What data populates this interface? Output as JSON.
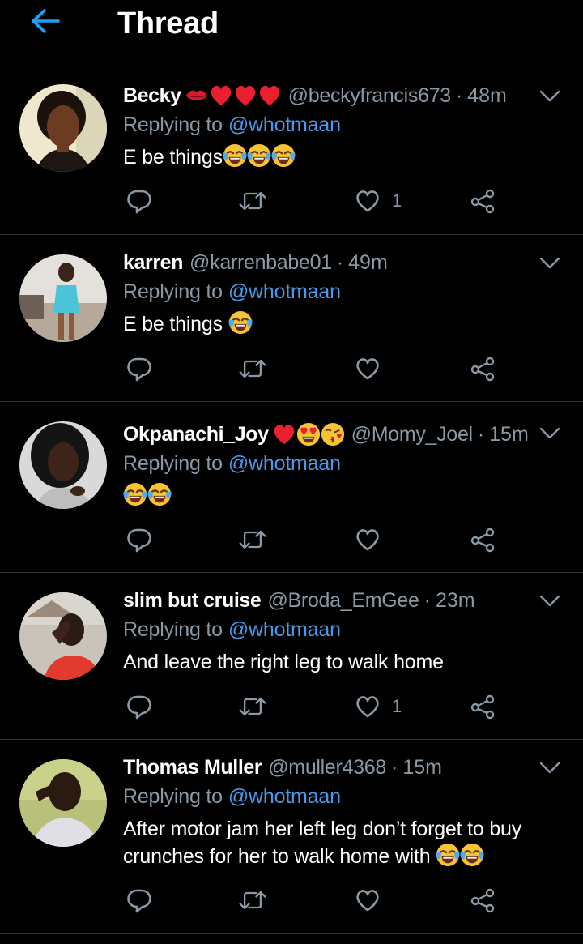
{
  "header": {
    "title": "Thread",
    "back_icon": "arrow-left-icon",
    "accent": "#1da1f2"
  },
  "colors": {
    "background": "#000000",
    "muted": "#8b98a5",
    "link": "#4a99e9",
    "divider": "#2f3336"
  },
  "tweets": [
    {
      "name": "Becky",
      "name_emojis": [
        "lips-icon",
        "red-heart-icon",
        "red-heart-icon",
        "red-heart-icon"
      ],
      "handle": "@beckyfrancis673",
      "time": "48m",
      "replying_label": "Replying to",
      "mention": "@whotmaan",
      "text": "E be things",
      "text_emojis": [
        "tears-of-joy-icon",
        "tears-of-joy-icon",
        "tears-of-joy-icon"
      ],
      "like_count": "1"
    },
    {
      "name": "karren",
      "name_emojis": [],
      "handle": "@karrenbabe01",
      "time": "49m",
      "replying_label": "Replying to",
      "mention": "@whotmaan",
      "text": "E be things",
      "text_emojis": [
        "tears-of-joy-icon"
      ],
      "like_count": ""
    },
    {
      "name": "Okpanachi_Joy",
      "name_emojis": [
        "red-heart-icon",
        "heart-eyes-icon",
        "kissing-face-icon"
      ],
      "handle": "@Momy_Joel",
      "time": "15m",
      "replying_label": "Replying to",
      "mention": "@whotmaan",
      "text": "",
      "text_emojis": [
        "tears-of-joy-icon",
        "tears-of-joy-icon"
      ],
      "like_count": ""
    },
    {
      "name": "slim but cruise",
      "name_emojis": [],
      "handle": "@Broda_EmGee",
      "time": "23m",
      "replying_label": "Replying to",
      "mention": "@whotmaan",
      "text": "And leave the right leg to walk home",
      "text_emojis": [],
      "like_count": "1"
    },
    {
      "name": "Thomas Muller",
      "name_emojis": [],
      "handle": "@muller4368",
      "time": "15m",
      "replying_label": "Replying to",
      "mention": "@whotmaan",
      "text_line1": "After motor jam her left leg don’t forget to buy",
      "text_line2": "crunches for her to walk home with",
      "text_emojis": [
        "tears-of-joy-icon",
        "tears-of-joy-icon"
      ],
      "like_count": ""
    }
  ],
  "separator": "·"
}
